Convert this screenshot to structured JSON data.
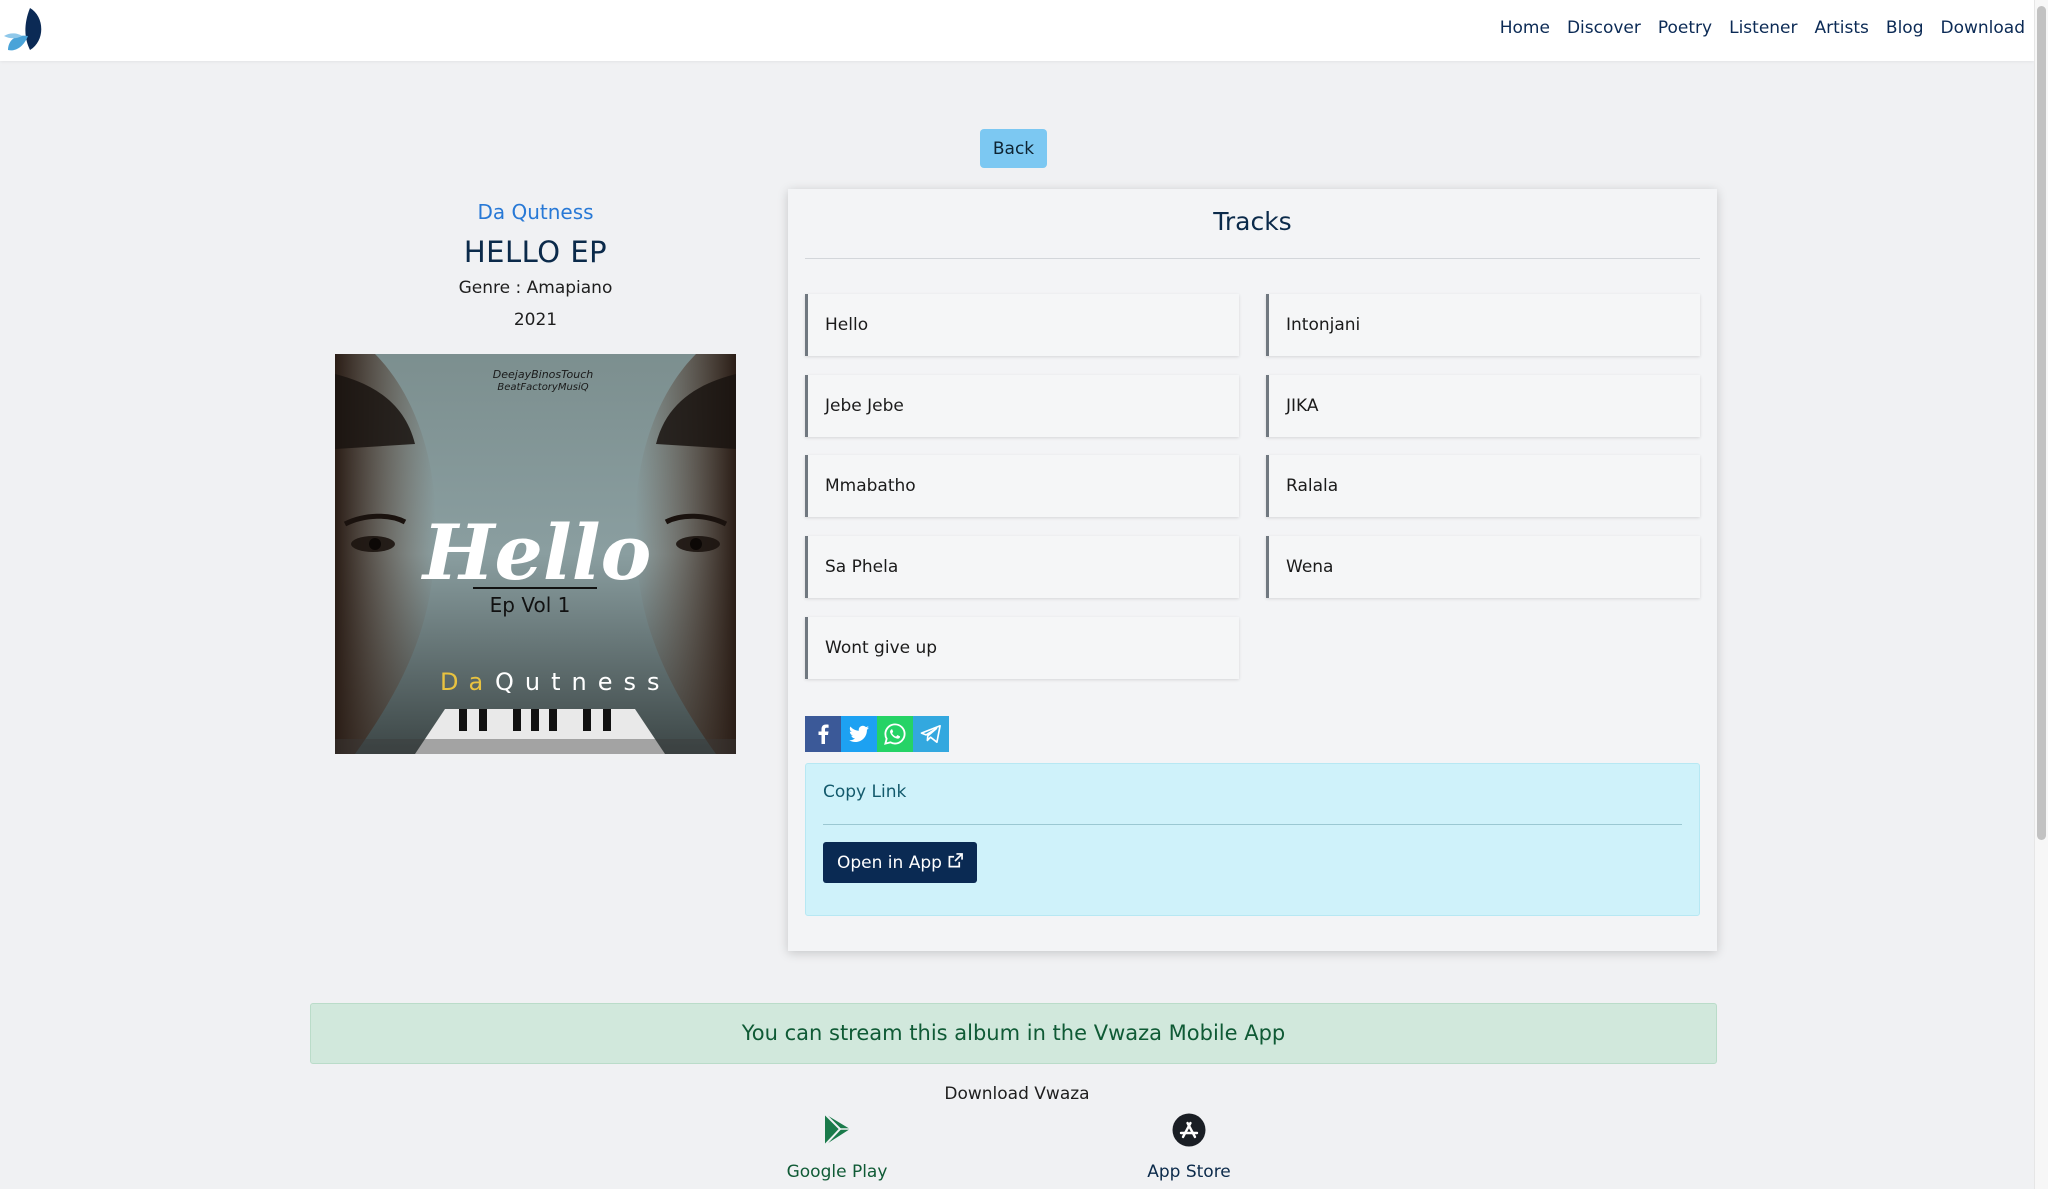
{
  "nav": {
    "links": [
      "Home",
      "Discover",
      "Poetry",
      "Listener",
      "Artists",
      "Blog",
      "Download"
    ]
  },
  "back_label": "Back",
  "album": {
    "artist": "Da Qutness",
    "title": "HELLO EP",
    "genre": "Genre : Amapiano",
    "year": "2021",
    "cover": {
      "credit_line1": "DeejayBinosTouch",
      "credit_line2": "BeatFactoryMusiQ",
      "script_title": "Hello",
      "subtitle": "Ep Vol 1",
      "artist_part1": "Da",
      "artist_part2": "Qutness"
    }
  },
  "tracks": {
    "heading": "Tracks",
    "items": [
      "Hello",
      "Intonjani",
      "Jebe Jebe",
      "JIKA",
      "Mmabatho",
      "Ralala",
      "Sa Phela",
      "Wena",
      "Wont give up"
    ]
  },
  "share": {
    "icons": [
      "facebook-icon",
      "twitter-icon",
      "whatsapp-icon",
      "telegram-icon"
    ],
    "copy_link": "Copy Link",
    "open_in_app": "Open in App"
  },
  "stream_banner": "You can stream this album in the Vwaza Mobile App",
  "download": {
    "label": "Download Vwaza",
    "google_play": "Google Play",
    "app_store": "App Store"
  },
  "colors": {
    "accent_blue": "#2879d6",
    "navy": "#0a2a53",
    "back_button": "#7cc8f2",
    "copy_box": "#cff2fa",
    "banner": "#d1e8dc",
    "banner_text": "#0f5a35"
  }
}
